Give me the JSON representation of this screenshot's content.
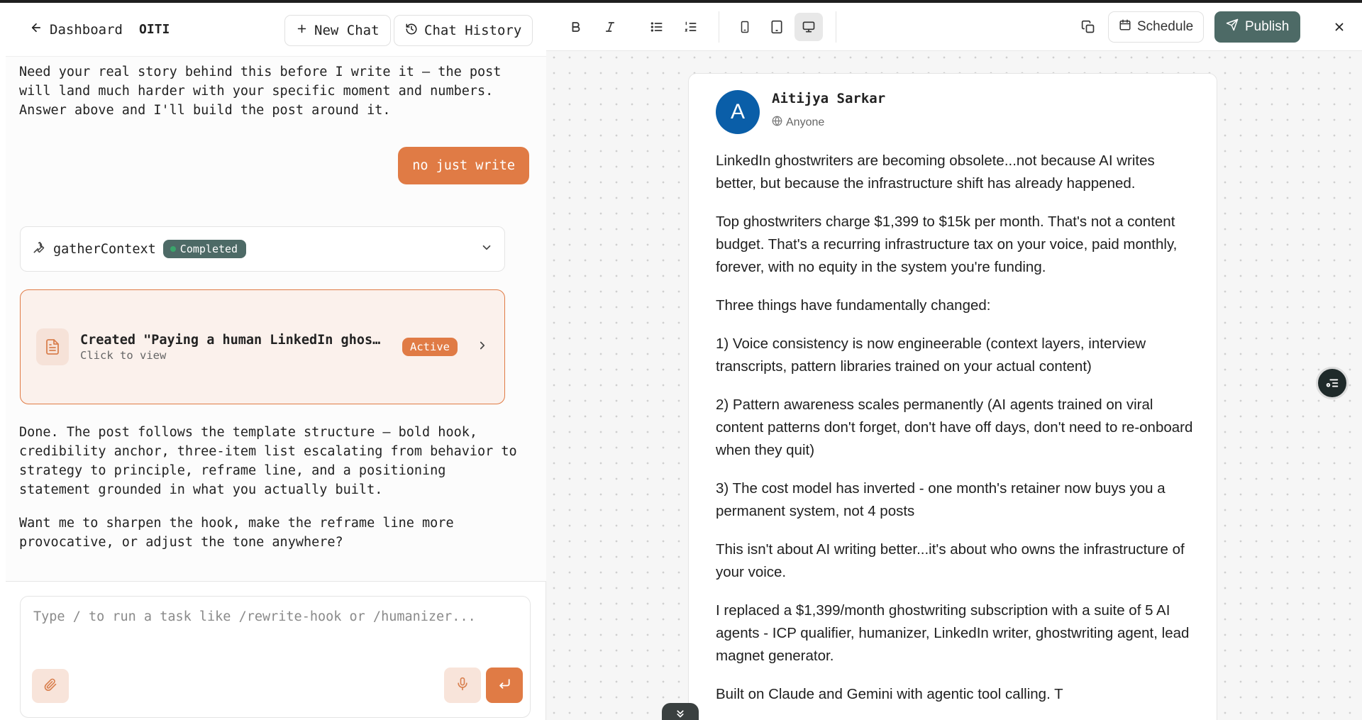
{
  "header": {
    "back_label": "Dashboard",
    "brand": "OITI",
    "new_chat_label": "New Chat",
    "history_label": "Chat History"
  },
  "chat": {
    "assistant_msg_1": "Need your real story behind this before I write it — the post will land much harder with your specific moment and numbers. Answer above and I'll build the post around it.",
    "user_msg": "no just write",
    "tool": {
      "name": "gatherContext",
      "status": "Completed"
    },
    "document": {
      "title": "Created \"Paying a human LinkedIn ghostwriter",
      "subtitle": "Click to view",
      "status": "Active"
    },
    "assistant_msg_2": "Done. The post follows the template structure — bold hook, credibility anchor, three-item list escalating from behavior to strategy to principle, reframe line, and a positioning statement grounded in what you actually built.",
    "assistant_msg_3": "Want me to sharpen the hook, make the reframe line more provocative, or adjust the tone anywhere?"
  },
  "composer": {
    "placeholder": "Type / to run a task like /rewrite-hook or /humanizer...",
    "value": ""
  },
  "editor_toolbar": {
    "schedule_label": "Schedule",
    "publish_label": "Publish",
    "active_device": "desktop"
  },
  "post": {
    "author": "Aitijya Sarkar",
    "avatar_initial": "A",
    "visibility": "Anyone",
    "paragraphs": [
      "LinkedIn ghostwriters are becoming obsolete...not because AI writes better, but because the infrastructure shift has already happened.",
      "Top ghostwriters charge $1,399 to $15k per month. That's not a content budget. That's a recurring infrastructure tax on your voice, paid monthly, forever, with no equity in the system you're funding.",
      "Three things have fundamentally changed:",
      "1) Voice consistency is now engineerable (context layers, interview transcripts, pattern libraries trained on your actual content)",
      "2) Pattern awareness scales permanently (AI agents trained on viral content patterns don't forget, don't have off days, don't need to re-onboard when they quit)",
      "3) The cost model has inverted - one month's retainer now buys you a permanent system, not 4 posts",
      "This isn't about AI writing better...it's about who owns the infrastructure of your voice.",
      "I replaced a $1,399/month ghostwriting subscription with a suite of 5 AI agents - ICP qualifier, humanizer, LinkedIn writer, ghostwriting agent, lead magnet generator.",
      "Built on Claude and Gemini with agentic tool calling. T"
    ]
  },
  "colors": {
    "accent": "#e07b45",
    "publish": "#4d6a66",
    "avatar": "#0a5ea8"
  }
}
